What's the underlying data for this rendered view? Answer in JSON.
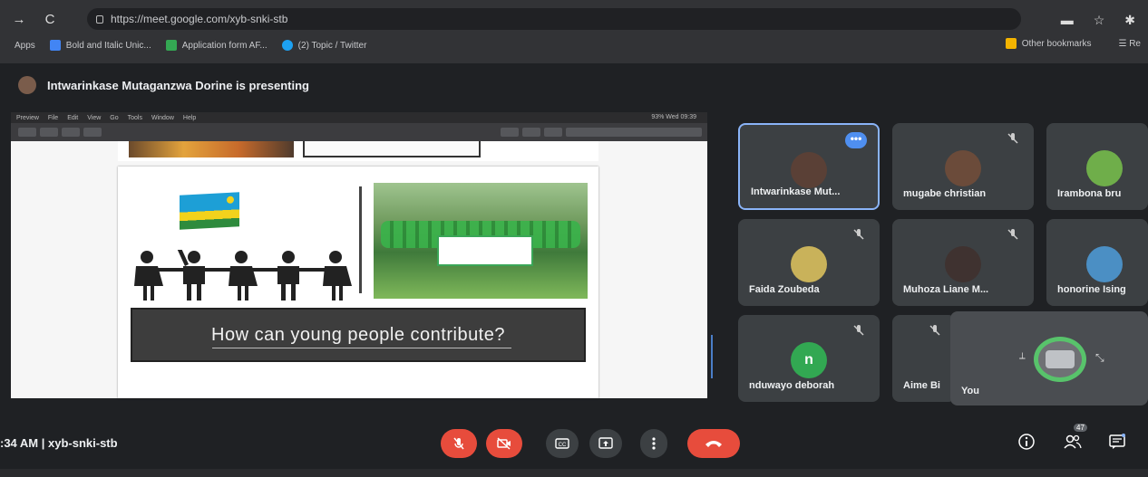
{
  "browser": {
    "url": "https://meet.google.com/xyb-snki-stb",
    "bookmarks": [
      {
        "label": "Apps",
        "color": ""
      },
      {
        "label": "Bold and Italic Unic...",
        "color": "#4285f4"
      },
      {
        "label": "Application form AF...",
        "color": "#34a853"
      },
      {
        "label": "(2) Topic / Twitter",
        "color": "#1da1f2"
      }
    ],
    "other_bookmarks": "Other bookmarks",
    "reading_list": "Re"
  },
  "presenter": {
    "text": "Intwarinkase Mutaganzwa Dorine is presenting"
  },
  "shared_screen": {
    "mac_menu": [
      "Preview",
      "File",
      "Edit",
      "View",
      "Go",
      "Tools",
      "Window",
      "Help"
    ],
    "mac_status": "93% Wed 09:39",
    "slide_question": "How can young people contribute?"
  },
  "participants": [
    {
      "name": "Intwarinkase Mut...",
      "avatar_color": "#5a4036",
      "active": true,
      "muted": false
    },
    {
      "name": "mugabe christian",
      "avatar_color": "#6b4b3a",
      "active": false,
      "muted": true
    },
    {
      "name": "Irambona bru",
      "avatar_color": "#6fae4a",
      "active": false,
      "muted": false
    },
    {
      "name": "Faida Zoubeda",
      "avatar_color": "#c9b25a",
      "active": false,
      "muted": true
    },
    {
      "name": "Muhoza Liane M...",
      "avatar_color": "#3f3230",
      "active": false,
      "muted": true
    },
    {
      "name": "honorine Ising",
      "avatar_color": "#4b8fc4",
      "active": false,
      "muted": false
    },
    {
      "name": "nduwayo deborah",
      "avatar_letter": "n",
      "avatar_color": "#32a852",
      "active": false,
      "muted": true
    },
    {
      "name": "Aime Bi",
      "avatar_color": "#8a8d91",
      "active": false,
      "muted": true
    }
  ],
  "self_tile": {
    "name": "You"
  },
  "bottom": {
    "meeting_info": ":34 AM  |  xyb-snki-stb",
    "participant_count": "47"
  },
  "colors": {
    "accent_red": "#e74c3c",
    "active_border": "#8ab4f8",
    "tile_bg": "#3c4043"
  }
}
